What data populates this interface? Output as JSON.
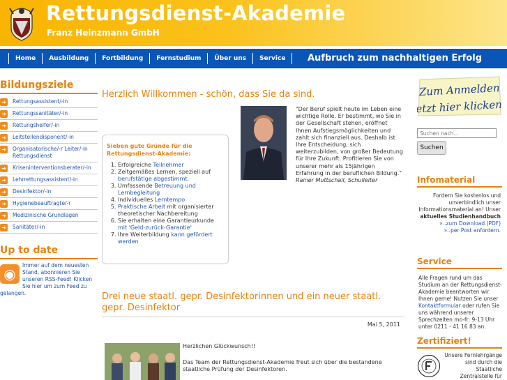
{
  "header": {
    "title": "Rettungsdienst-Akademie",
    "subtitle": "Franz Heinzmann GmbH",
    "logo_icon": "coat-of-arms-icon"
  },
  "nav": {
    "items": [
      "Home",
      "Ausbildung",
      "Fortbildung",
      "Fernstudium",
      "Über uns",
      "Service"
    ],
    "slogan": "Aufbruch zum nachhaltigen Erfolg"
  },
  "left": {
    "education_heading": "Bildungsziele",
    "education_items": [
      "Rettungsassistent/-in",
      "Rettungssanitäter/-in",
      "Rettungshelfer/-in",
      "Leitstellendisponent/-in",
      "Organisatorische/-r Leiter/-in Rettungsdienst",
      "Kriseninterventionsberater/-in",
      "Lehrrettungsassistent/-in",
      "Desinfektor/-in",
      "Hygienebeauftragte/-r",
      "Medizinische Grundlagen",
      "Sanitäter/-in"
    ],
    "uptodate_heading": "Up to date",
    "uptodate_text": "Immer auf dem neuesten Stand, abonnieren Sie unseren RSS-Feed! Klicken Sie hier um zum Feed zu gelangen."
  },
  "main": {
    "welcome": "Herzlich Willkommen - schön, dass Sie da sind.",
    "reasons_heading": "Sieben gute Gründe für die Rettungsdienst-Akademie:",
    "quote": "\"Der Beruf spielt heute im Leben eine wichtige Rolle. Er bestimmt, wo Sie in der Gesellschaft stehen, eröffnet Ihnen Aufstiegsmöglichkeiten und zahlt sich finanziell aus. Deshalb ist Ihre Entscheidung, sich weiterzubilden, von großer Bedeutung für Ihre Zukunft. Profitieren Sie von unserer mehr als 15jährigen Erfahrung in der beruflichen Bildung.\"",
    "quote_author": "Rainer Muttschall, Schulleiter",
    "news_title": "Drei neue staatl. gepr. Desinfektorinnen und ein neuer staatl. gepr. Desinfektor",
    "news_date": "Mai 5, 2011",
    "news_p1": "Herzlichen Glückwunsch!!",
    "news_p2": "Das Team der Rettungsdienst-Akademie freut sich über die bestandene staatliche Prüfung der Desinfektoren."
  },
  "right": {
    "signup_line1": "Zum Anmelden",
    "signup_line2": "jetzt hier klicken!",
    "search_placeholder": "Suchen nach...",
    "search_button": "Suchen",
    "info_heading": "Infomaterial",
    "info_text": "Fordern Sie kostenlos und unverbindlich unser Informationsmaterial an! Unser",
    "info_bold": "aktuelles Studienhandbuch",
    "info_link1": "»..zum Download (PDF)",
    "info_link2": "»..per Post anfordern.",
    "service_heading": "Service",
    "service_text": "Alle Fragen rund um das Studium an der Rettungsdienst-Akademie beantworten wir Ihnen gerne! Nutzen Sie unser",
    "service_link": "Kontaktformular",
    "service_text2": "oder rufen Sie uns während unserer Sprechzeiten mo-fr: 9-13 Uhr unter 0211 - 41 16 83 an.",
    "cert_heading": "Zertifiziert!",
    "cert_text": "Unsere Fernlehrgänge sind durch die Staatliche Zentralstelle für"
  },
  "colors": {
    "header_orange": "#fbc21c",
    "nav_blue": "#0a56b8",
    "heading_orange": "#e8820c",
    "link_blue": "#2255aa"
  }
}
